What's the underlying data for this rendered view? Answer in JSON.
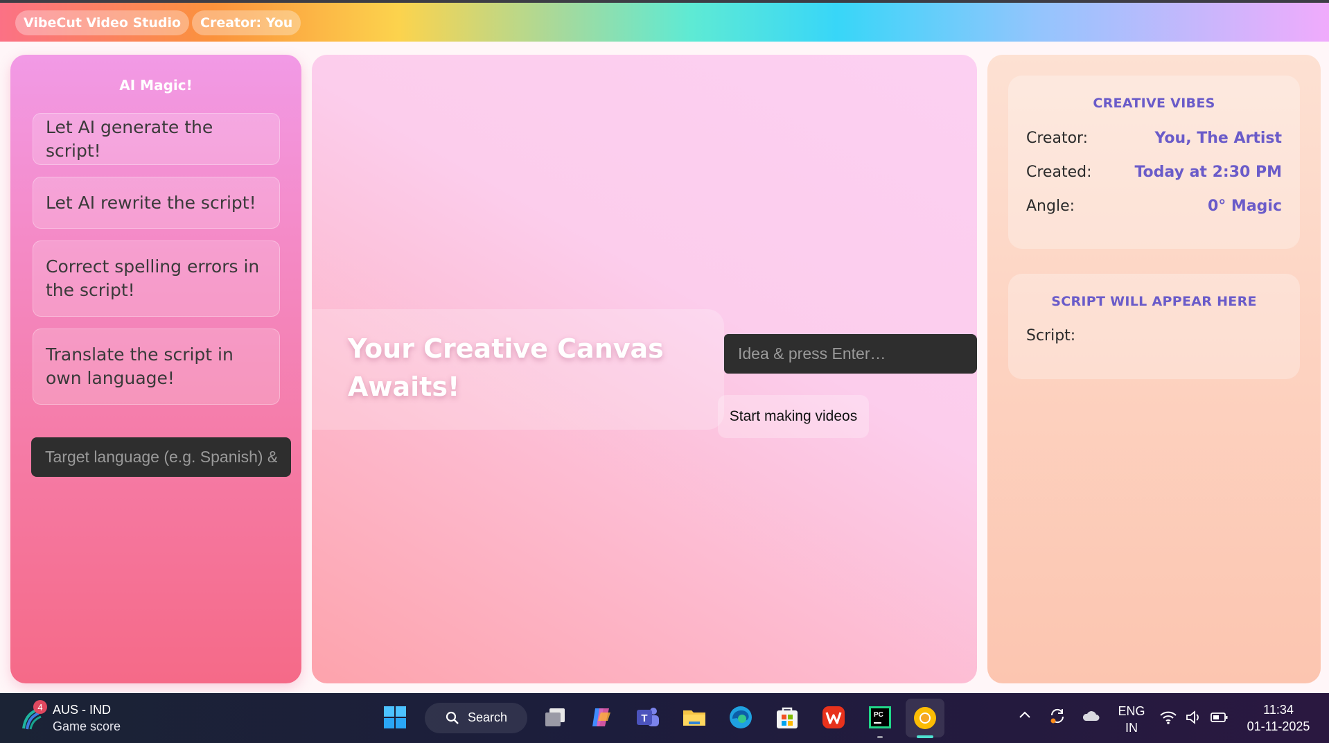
{
  "header": {
    "app_name": "VibeCut Video Studio",
    "creator_badge": "Creator: You"
  },
  "left_panel": {
    "title": "AI Magic!",
    "buttons": [
      "Let AI generate the script!",
      "Let AI rewrite the script!",
      "Correct spelling errors in the script!",
      "Translate the script in own language!"
    ],
    "language_input": {
      "placeholder": "Target language (e.g. Spanish) & press Enter",
      "value": ""
    }
  },
  "center": {
    "hero_title": "Your Creative Canvas Awaits!",
    "idea_input": {
      "placeholder": "Idea & press Enter…",
      "value": ""
    },
    "start_button": "Start making videos"
  },
  "right_panel": {
    "vibes_card": {
      "title": "CREATIVE VIBES",
      "rows": [
        {
          "label": "Creator:",
          "value": "You, The Artist"
        },
        {
          "label": "Created:",
          "value": "Today at 2:30 PM"
        },
        {
          "label": "Angle:",
          "value": "0° Magic"
        }
      ]
    },
    "script_card": {
      "title": "SCRIPT WILL APPEAR HERE",
      "label": "Script:"
    }
  },
  "taskbar": {
    "widget": {
      "badge": "4",
      "title": "AUS - IND",
      "subtitle": "Game score"
    },
    "search_label": "Search",
    "language": {
      "line1": "ENG",
      "line2": "IN"
    },
    "clock": {
      "time": "11:34",
      "date": "01-11-2025"
    }
  },
  "colors": {
    "accent_purple": "#6a5bc9",
    "input_dark": "#2e2e2e"
  }
}
